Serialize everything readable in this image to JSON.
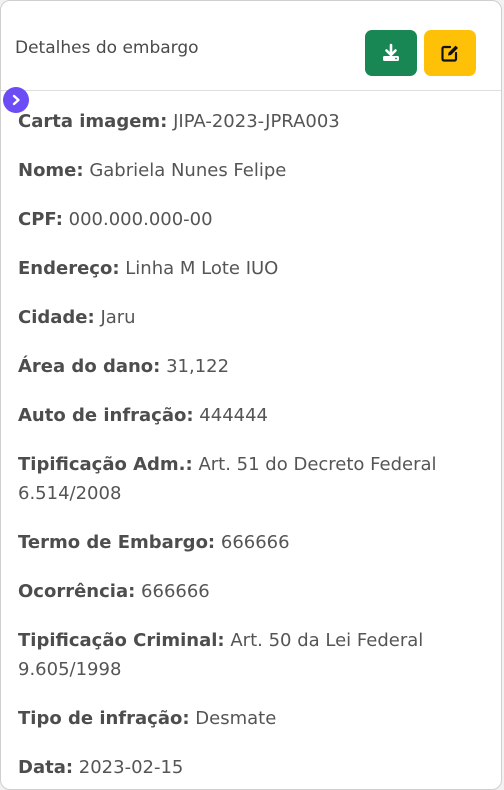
{
  "panel": {
    "title": "Detalhes do embargo",
    "download_icon": "download-icon",
    "edit_icon": "edit-icon",
    "toggle_icon": "chevron-right-icon"
  },
  "fields": [
    {
      "label": "Carta imagem:",
      "value": "JIPA-2023-JPRA003"
    },
    {
      "label": "Nome:",
      "value": "Gabriela Nunes Felipe"
    },
    {
      "label": "CPF:",
      "value": "000.000.000-00"
    },
    {
      "label": "Endereço:",
      "value": "Linha M Lote IUO"
    },
    {
      "label": "Cidade:",
      "value": "Jaru"
    },
    {
      "label": "Área do dano:",
      "value": "31,122"
    },
    {
      "label": "Auto de infração:",
      "value": "444444"
    },
    {
      "label": "Tipificação Adm.:",
      "value": "Art. 51 do Decreto Federal 6.514/2008"
    },
    {
      "label": "Termo de Embargo:",
      "value": "666666"
    },
    {
      "label": "Ocorrência:",
      "value": "666666"
    },
    {
      "label": "Tipificação Criminal:",
      "value": "Art. 50 da Lei Federal 9.605/1998"
    },
    {
      "label": "Tipo de infração:",
      "value": "Desmate"
    },
    {
      "label": "Data:",
      "value": "2023-02-15"
    }
  ],
  "colors": {
    "download_button": "#198754",
    "edit_button": "#ffc107",
    "toggle": "#6c4cf5"
  }
}
